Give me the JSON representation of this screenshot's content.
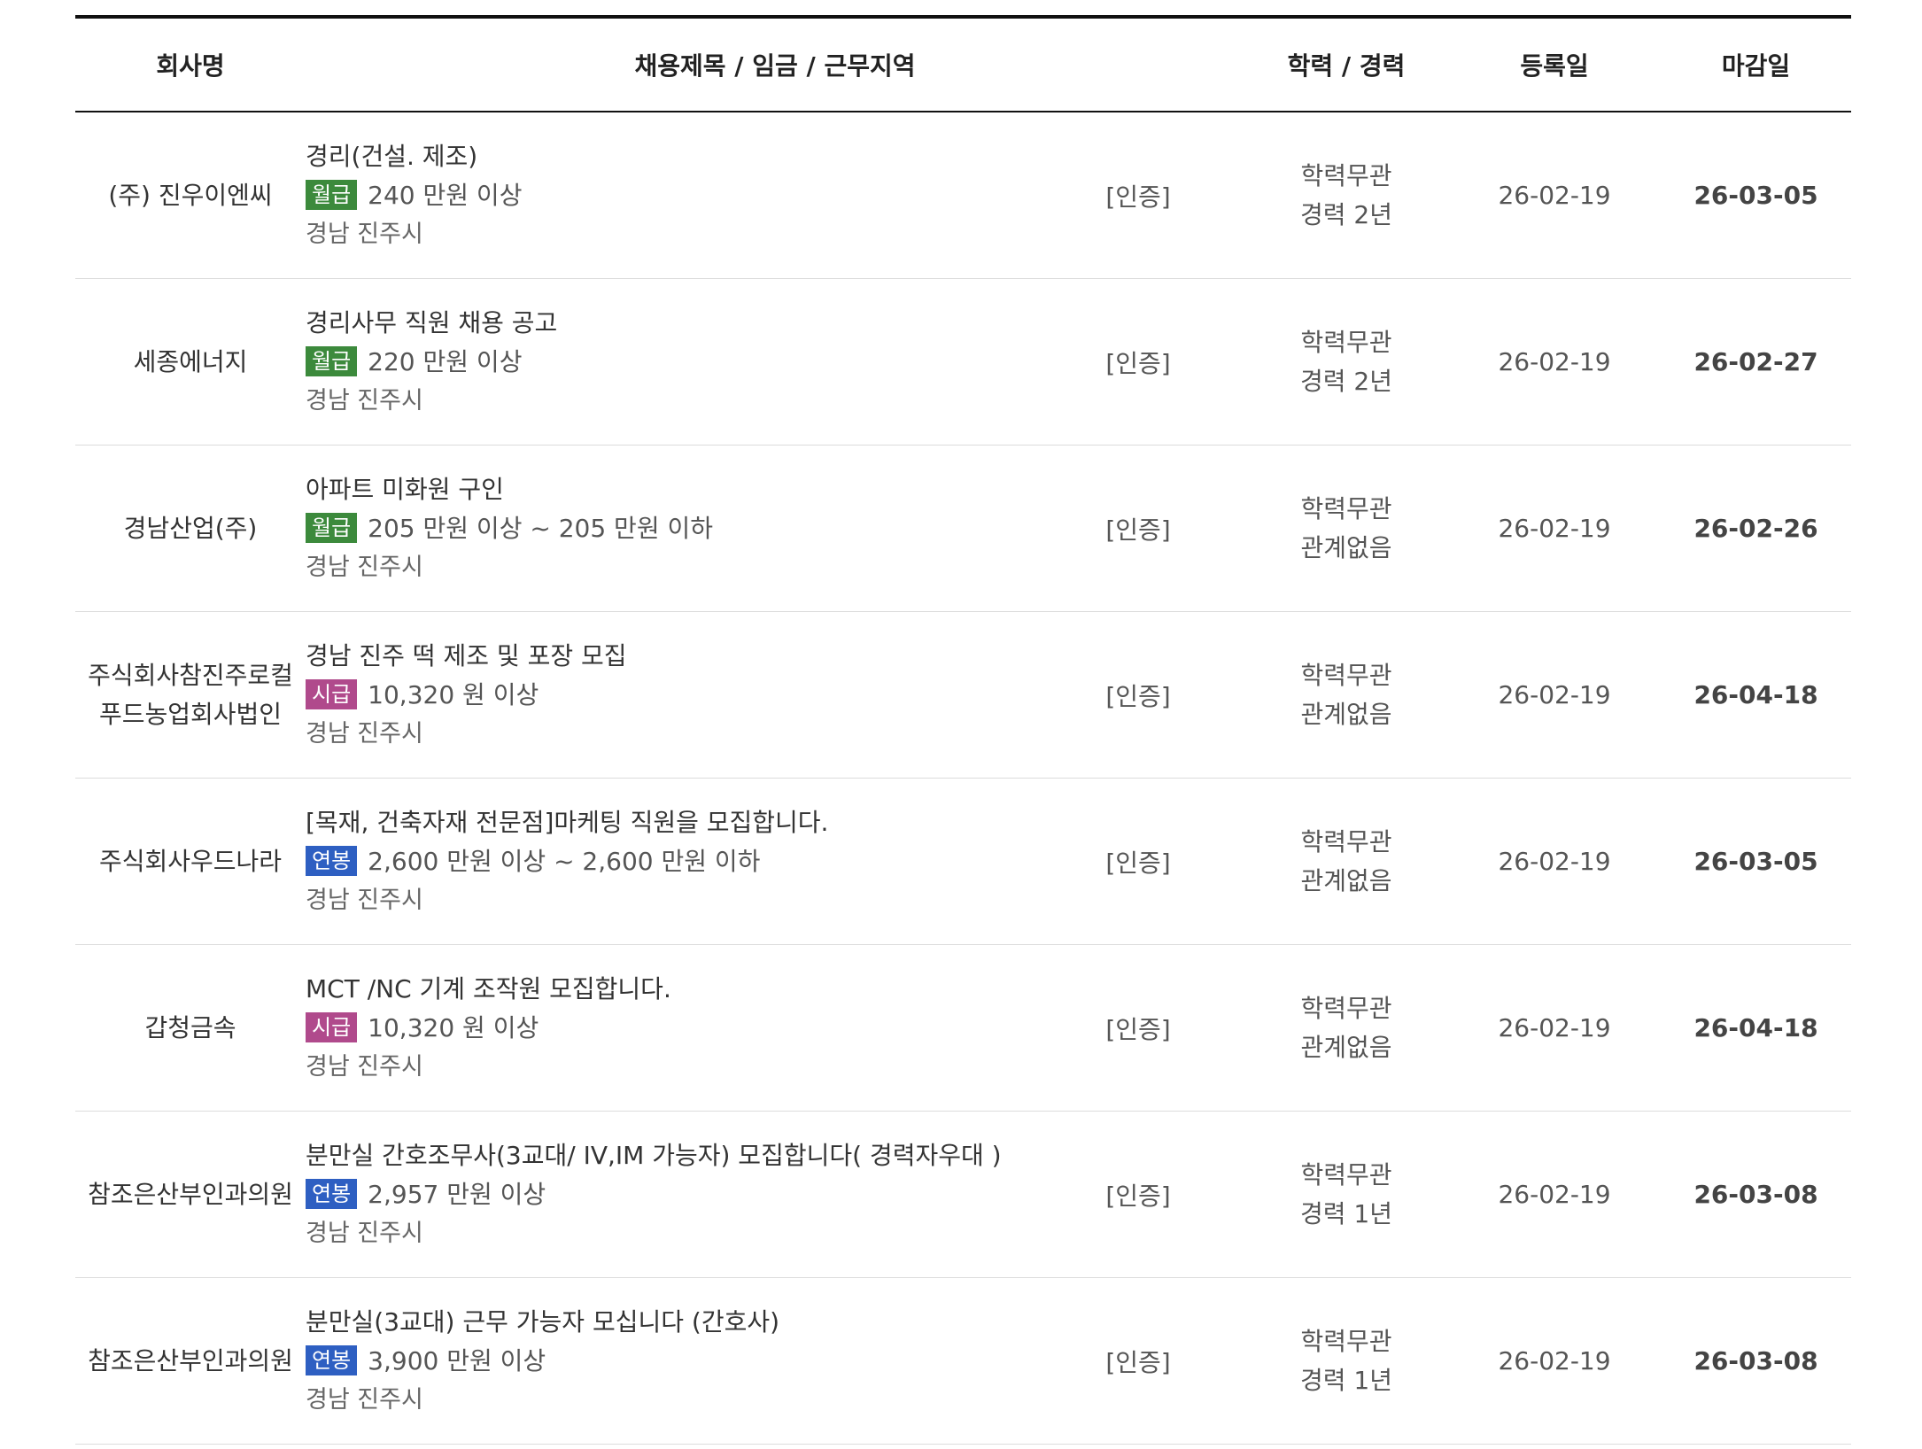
{
  "header": {
    "company": "회사명",
    "info": "채용제목 / 임금 / 근무지역",
    "edu": "학력 / 경력",
    "registered": "등록일",
    "deadline": "마감일"
  },
  "badge_colors": {
    "월급": "#3c8a3c",
    "시급": "#b04a8c",
    "연봉": "#2e5fc2"
  },
  "rows": [
    {
      "company": [
        "(주) 진우이엔씨"
      ],
      "title": "경리(건설. 제조)",
      "pay_type": "월급",
      "pay": "240 만원 이상",
      "region": "경남 진주시",
      "cert": "[인증]",
      "education": "학력무관",
      "career": "경력 2년",
      "registered": "26-02-19",
      "deadline": "26-03-05"
    },
    {
      "company": [
        "세종에너지"
      ],
      "title": "경리사무 직원 채용 공고",
      "pay_type": "월급",
      "pay": "220 만원 이상",
      "region": "경남 진주시",
      "cert": "[인증]",
      "education": "학력무관",
      "career": "경력 2년",
      "registered": "26-02-19",
      "deadline": "26-02-27"
    },
    {
      "company": [
        "경남산업(주)"
      ],
      "title": "아파트 미화원 구인",
      "pay_type": "월급",
      "pay": "205 만원 이상 ~ 205 만원 이하",
      "region": "경남 진주시",
      "cert": "[인증]",
      "education": "학력무관",
      "career": "관계없음",
      "registered": "26-02-19",
      "deadline": "26-02-26"
    },
    {
      "company": [
        "주식회사참진주로컬",
        "푸드농업회사법인"
      ],
      "title": "경남 진주 떡 제조 및 포장 모집",
      "pay_type": "시급",
      "pay": "10,320 원 이상",
      "region": "경남 진주시",
      "cert": "[인증]",
      "education": "학력무관",
      "career": "관계없음",
      "registered": "26-02-19",
      "deadline": "26-04-18"
    },
    {
      "company": [
        "주식회사우드나라"
      ],
      "title": "[목재, 건축자재 전문점]마케팅 직원을 모집합니다.",
      "pay_type": "연봉",
      "pay": "2,600 만원 이상 ~ 2,600 만원 이하",
      "region": "경남 진주시",
      "cert": "[인증]",
      "education": "학력무관",
      "career": "관계없음",
      "registered": "26-02-19",
      "deadline": "26-03-05"
    },
    {
      "company": [
        "갑청금속"
      ],
      "title": "MCT /NC 기계 조작원 모집합니다.",
      "pay_type": "시급",
      "pay": "10,320 원 이상",
      "region": "경남 진주시",
      "cert": "[인증]",
      "education": "학력무관",
      "career": "관계없음",
      "registered": "26-02-19",
      "deadline": "26-04-18"
    },
    {
      "company": [
        "참조은산부인과의원"
      ],
      "title": "분만실 간호조무사(3교대/ IV,IM 가능자) 모집합니다( 경력자우대 )",
      "pay_type": "연봉",
      "pay": "2,957 만원 이상",
      "region": "경남 진주시",
      "cert": "[인증]",
      "education": "학력무관",
      "career": "경력 1년",
      "registered": "26-02-19",
      "deadline": "26-03-08"
    },
    {
      "company": [
        "참조은산부인과의원"
      ],
      "title": "분만실(3교대) 근무 가능자 모십니다 (간호사)",
      "pay_type": "연봉",
      "pay": "3,900 만원 이상",
      "region": "경남 진주시",
      "cert": "[인증]",
      "education": "학력무관",
      "career": "경력 1년",
      "registered": "26-02-19",
      "deadline": "26-03-08"
    }
  ]
}
